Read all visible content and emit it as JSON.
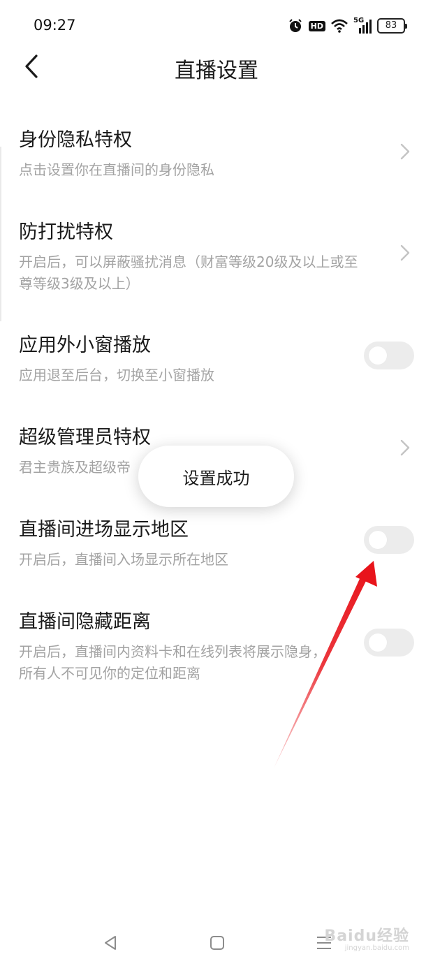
{
  "status_bar": {
    "time": "09:27",
    "icons": [
      "alarm-icon",
      "hd-icon",
      "wifi-icon",
      "5g-signal-icon"
    ],
    "hd_label": "HD",
    "network_label": "5G",
    "battery": "83"
  },
  "header": {
    "title": "直播设置",
    "back_icon": "chevron-left-icon"
  },
  "settings": [
    {
      "title": "身份隐私特权",
      "desc": "点击设置你在直播间的身份隐私",
      "control": "chevron"
    },
    {
      "title": "防打扰特权",
      "desc": "开启后，可以屏蔽骚扰消息（财富等级20级及以上或至尊等级3级及以上）",
      "control": "chevron"
    },
    {
      "title": "应用外小窗播放",
      "desc": "应用退至后台，切换至小窗播放",
      "control": "toggle",
      "on": false
    },
    {
      "title": "超级管理员特权",
      "desc": "君主贵族及超级帝",
      "control": "chevron"
    },
    {
      "title": "直播间进场显示地区",
      "desc": "开启后，直播间入场显示所在地区",
      "control": "toggle",
      "on": false
    },
    {
      "title": "直播间隐藏距离",
      "desc": "开启后，直播间内资料卡和在线列表将展示隐身，所有人不可见你的定位和距离",
      "control": "toggle",
      "on": false
    }
  ],
  "toast": {
    "text": "设置成功"
  },
  "annotation": {
    "color": "#e8141b"
  },
  "nav_bar": {
    "icons": [
      "back-triangle-icon",
      "home-square-icon",
      "menu-lines-icon"
    ]
  },
  "watermark": {
    "main": "Baidu经验",
    "sub": "jingyan.baidu.com"
  }
}
